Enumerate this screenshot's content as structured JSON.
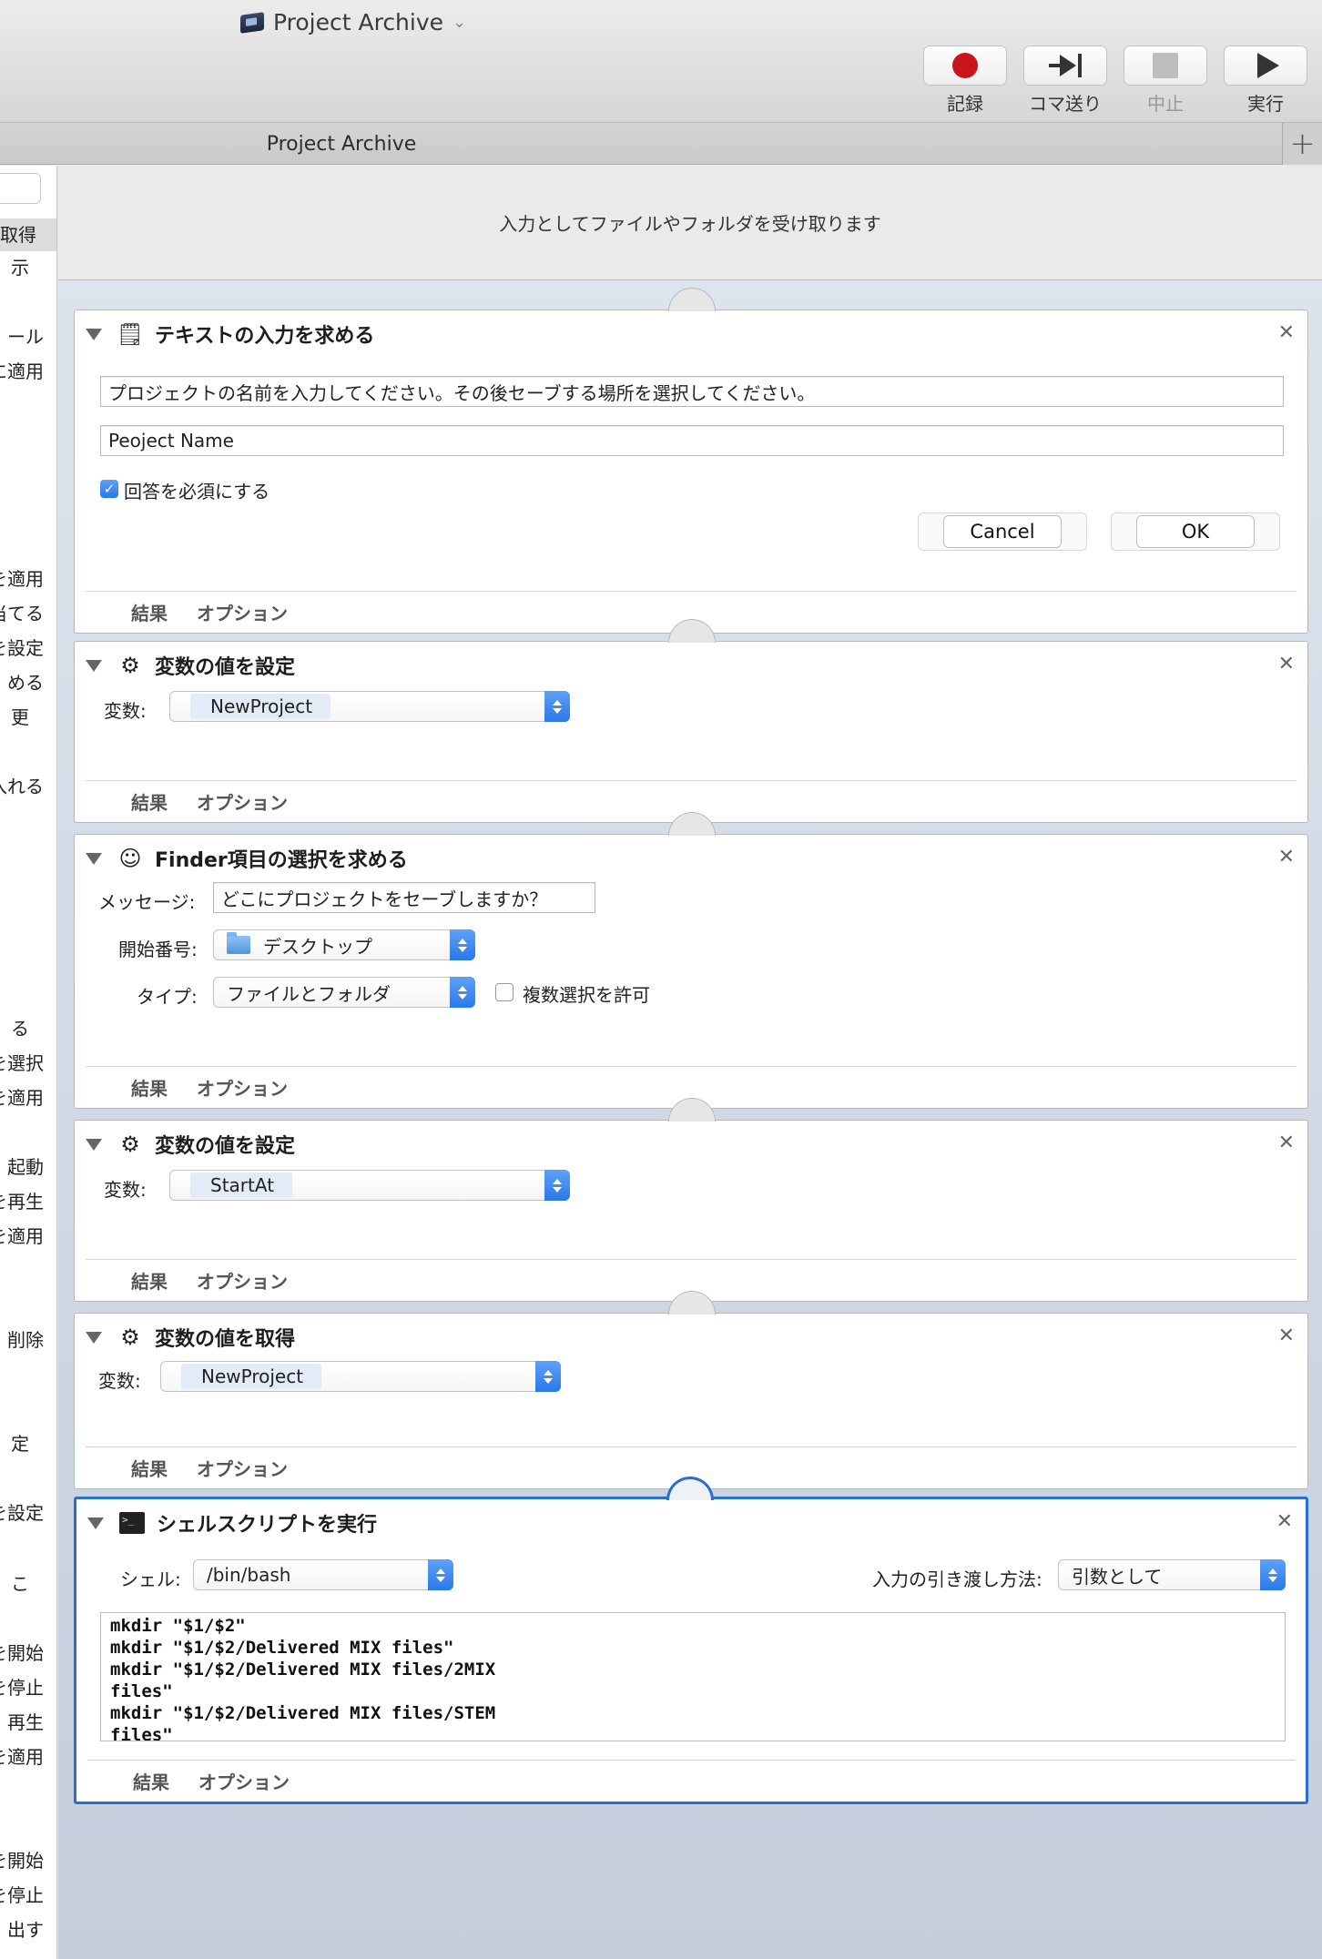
{
  "window": {
    "title": "Project Archive"
  },
  "toolbar": {
    "record_label": "記録",
    "step_label": "コマ送り",
    "stop_label": "中止",
    "run_label": "実行"
  },
  "tab": {
    "title": "Project Archive",
    "add_symbol": "+"
  },
  "library": {
    "items": [
      "取得",
      "示",
      "ール",
      "に適用",
      "を適用",
      "当てる",
      "を設定",
      "める",
      "更",
      "入れる",
      "る",
      "を選択",
      "を適用",
      "起動",
      "を再生",
      "を適用",
      "削除",
      "定",
      "を設定",
      "こ",
      "を開始",
      "を停止",
      "再生",
      "を適用",
      "を開始",
      "を停止",
      "出す"
    ]
  },
  "workflow": {
    "input_header": "入力としてファイルやフォルダを受け取ります",
    "footer_results": "結果",
    "footer_options": "オプション",
    "actions": [
      {
        "title": "テキストの入力を求める",
        "prompt": "プロジェクトの名前を入力してください。その後セーブする場所を選択してください。",
        "default_answer": "Peoject Name",
        "require_answer_label": "回答を必須にする",
        "cancel_label": "Cancel",
        "ok_label": "OK"
      },
      {
        "title": "変数の値を設定",
        "variable_label": "変数:",
        "variable_value": "NewProject"
      },
      {
        "title": "Finder項目の選択を求める",
        "message_label": "メッセージ:",
        "message_value": "どこにプロジェクトをセーブしますか？",
        "start_label": "開始番号:",
        "start_value": "デスクトップ",
        "type_label": "タイプ:",
        "type_value": "ファイルとフォルダ",
        "multi_label": "複数選択を許可"
      },
      {
        "title": "変数の値を設定",
        "variable_label": "変数:",
        "variable_value": "StartAt"
      },
      {
        "title": "変数の値を取得",
        "variable_label": "変数:",
        "variable_value": "NewProject"
      },
      {
        "title": "シェルスクリプトを実行",
        "shell_label": "シェル:",
        "shell_value": "/bin/bash",
        "pass_label": "入力の引き渡し方法:",
        "pass_value": "引数として",
        "script": "mkdir \"$1/$2\"\nmkdir \"$1/$2/Delivered MIX files\"\nmkdir \"$1/$2/Delivered MIX files/2MIX\nfiles\"\nmkdir \"$1/$2/Delivered MIX files/STEM\nfiles\""
      }
    ]
  },
  "colors": {
    "accent": "#2a6fd0",
    "record": "#c9161d"
  }
}
